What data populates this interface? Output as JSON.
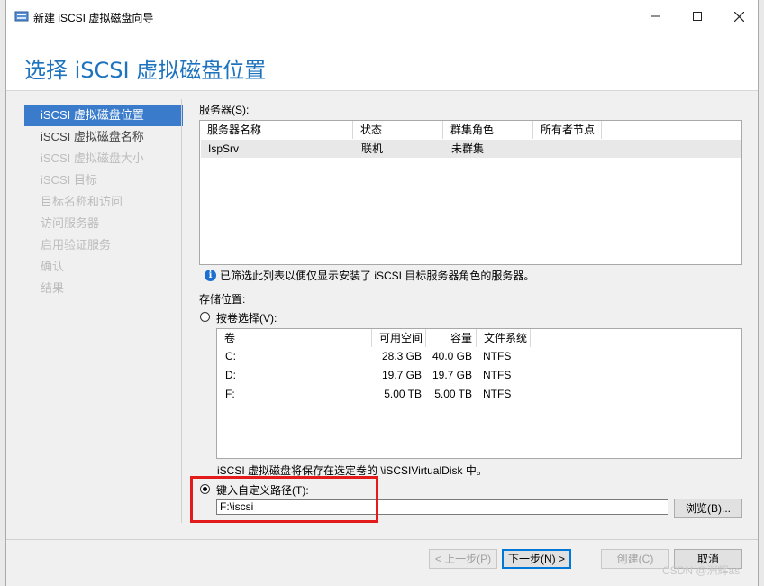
{
  "window": {
    "title": "新建 iSCSI 虚拟磁盘向导",
    "page_title": "选择 iSCSI 虚拟磁盘位置"
  },
  "nav": {
    "items": [
      {
        "label": "iSCSI 虚拟磁盘位置",
        "state": "active"
      },
      {
        "label": "iSCSI 虚拟磁盘名称",
        "state": "enabled"
      },
      {
        "label": "iSCSI 虚拟磁盘大小",
        "state": "disabled"
      },
      {
        "label": "iSCSI 目标",
        "state": "disabled"
      },
      {
        "label": "目标名称和访问",
        "state": "disabled"
      },
      {
        "label": "访问服务器",
        "state": "disabled"
      },
      {
        "label": "启用验证服务",
        "state": "disabled"
      },
      {
        "label": "确认",
        "state": "disabled"
      },
      {
        "label": "结果",
        "state": "disabled"
      }
    ]
  },
  "servers": {
    "label": "服务器(S):",
    "columns": [
      "服务器名称",
      "状态",
      "群集角色",
      "所有者节点"
    ],
    "rows": [
      {
        "name": "IspSrv",
        "status": "联机",
        "cluster_role": "未群集",
        "owner_node": ""
      }
    ],
    "info": "已筛选此列表以便仅显示安装了 iSCSI 目标服务器角色的服务器。"
  },
  "storage": {
    "label": "存储位置:",
    "by_volume_label": "按卷选择(V):",
    "volume_columns": [
      "卷",
      "可用空间",
      "容量",
      "文件系统"
    ],
    "volumes": [
      {
        "volume": "C:",
        "free": "28.3 GB",
        "capacity": "40.0 GB",
        "fs": "NTFS"
      },
      {
        "volume": "D:",
        "free": "19.7 GB",
        "capacity": "19.7 GB",
        "fs": "NTFS"
      },
      {
        "volume": "F:",
        "free": "5.00 TB",
        "capacity": "5.00 TB",
        "fs": "NTFS"
      }
    ],
    "save_note": "iSCSI 虚拟磁盘将保存在选定卷的 \\iSCSIVirtualDisk 中。",
    "custom_path_label": "键入自定义路径(T):",
    "custom_path_value": "F:\\iscsi",
    "browse_label": "浏览(B)...",
    "selected_option": "custom"
  },
  "footer": {
    "prev": "< 上一步(P)",
    "next": "下一步(N) >",
    "create": "创建(C)",
    "cancel": "取消"
  },
  "watermark": "CSDN @洲辉as",
  "colors": {
    "accent": "#1e73be",
    "nav_active": "#3a7ccb",
    "highlight": "#e31b1b"
  }
}
